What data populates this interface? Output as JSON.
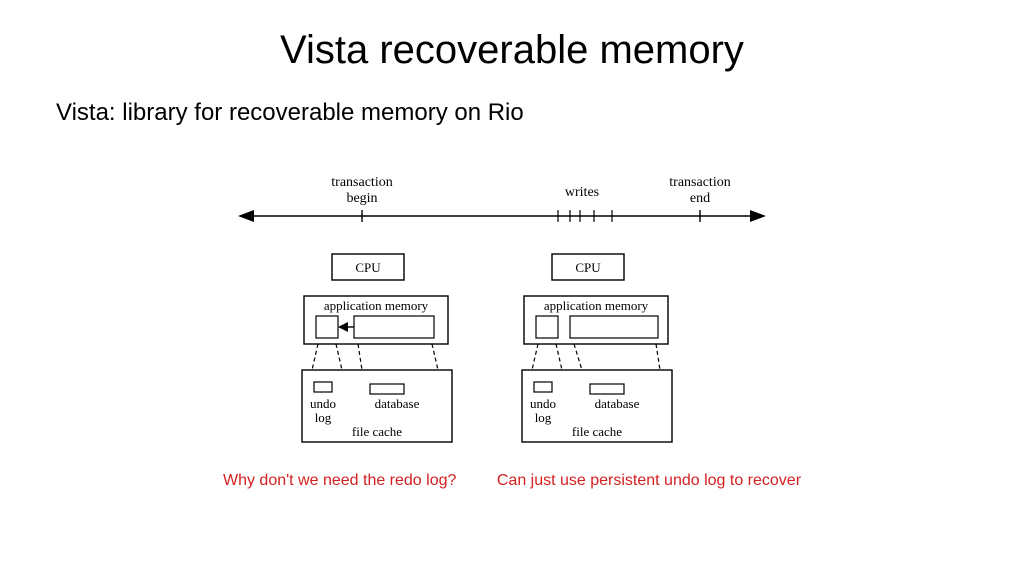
{
  "title": "Vista recoverable memory",
  "subtitle": "Vista: library for recoverable memory on Rio",
  "timeline": {
    "begin_l1": "transaction",
    "begin_l2": "begin",
    "writes": "writes",
    "end_l1": "transaction",
    "end_l2": "end"
  },
  "box": {
    "cpu": "CPU",
    "appmem": "application memory",
    "undo_l1": "undo",
    "undo_l2": "log",
    "database": "database",
    "filecache": "file cache"
  },
  "notes": {
    "question": "Why don't we need the redo log?",
    "answer": "Can just use persistent undo log to recover"
  }
}
